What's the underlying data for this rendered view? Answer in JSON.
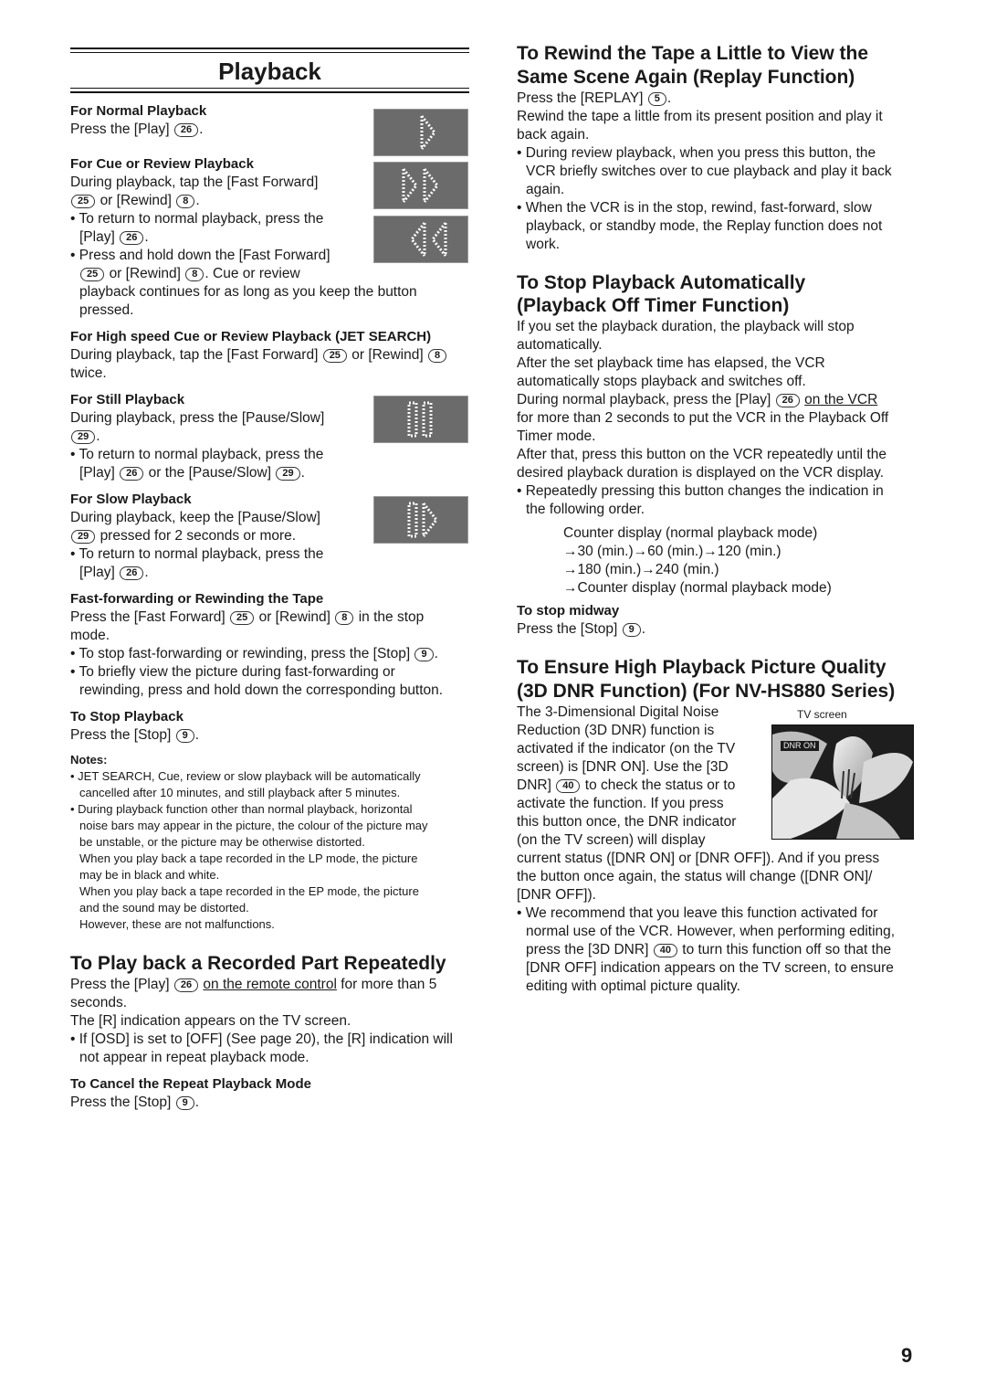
{
  "page_title": "Playback",
  "page_number": "9",
  "left": {
    "normal": {
      "heading": "For Normal Playback",
      "line1_pre": "Press the [Play]",
      "line1_key": "26",
      "line1_post": "."
    },
    "cue": {
      "heading": "For Cue or Review Playback",
      "l1": "During playback, tap the [Fast Forward]",
      "l2_key1": "25",
      "l2_mid": "or [Rewind]",
      "l2_key2": "8",
      "l2_post": ".",
      "b1_l1": "• To return to normal playback, press the",
      "b1_l2_pre": "[Play]",
      "b1_l2_key": "26",
      "b1_l2_post": ".",
      "b2_l1": "• Press and hold down the [Fast Forward]",
      "b2_l2_key1": "25",
      "b2_l2_mid": "or [Rewind]",
      "b2_l2_key2": "8",
      "b2_l2_post": ". Cue or review",
      "b2_l3": "playback continues for as long as you keep the button",
      "b2_l4": "pressed."
    },
    "jet": {
      "heading": "For High speed Cue or Review Playback (JET SEARCH)",
      "l1_pre": "During playback, tap the [Fast Forward]",
      "l1_key1": "25",
      "l1_mid": "or [Rewind]",
      "l1_key2": "8",
      "l2": "twice."
    },
    "still": {
      "heading": "For Still Playback",
      "l1": "During playback, press the [Pause/Slow]",
      "l2_key": "29",
      "l2_post": ".",
      "b1_l1": "• To return to normal playback, press the",
      "b1_l2_pre": "[Play]",
      "b1_l2_key1": "26",
      "b1_l2_mid": "or the [Pause/Slow]",
      "b1_l2_key2": "29",
      "b1_l2_post": "."
    },
    "slow": {
      "heading": "For Slow Playback",
      "l1": "During playback, keep the [Pause/Slow]",
      "l2_key": "29",
      "l2_post": "pressed for 2 seconds or more.",
      "b1_l1": "• To return to normal playback, press the",
      "b1_l2_pre": "[Play]",
      "b1_l2_key": "26",
      "b1_l2_post": "."
    },
    "ffrew": {
      "heading": "Fast-forwarding or Rewinding the Tape",
      "l1_pre": "Press the [Fast Forward]",
      "l1_key1": "25",
      "l1_mid": "or [Rewind]",
      "l1_key2": "8",
      "l1_post": "in the stop",
      "l2": "mode.",
      "b1_pre": "• To stop fast-forwarding or rewinding, press the [Stop]",
      "b1_key": "9",
      "b1_post": ".",
      "b2_l1": "• To briefly view the picture during fast-forwarding or",
      "b2_l2": "rewinding, press and hold down the corresponding button."
    },
    "stop": {
      "heading": "To Stop Playback",
      "l1_pre": "Press the [Stop]",
      "l1_key": "9",
      "l1_post": "."
    },
    "notes": {
      "heading": "Notes:",
      "lines": [
        "• JET SEARCH, Cue, review or slow playback will be automatically",
        "cancelled after 10 minutes, and still playback after 5 minutes.",
        "• During playback function other than normal playback, horizontal",
        "noise bars may appear in the picture, the colour of the picture may",
        "be unstable, or the picture may be otherwise distorted.",
        "When you play back a tape recorded in the LP mode, the picture",
        "may be in black and white.",
        "When you play back a tape recorded in the EP mode, the picture",
        "and the sound may be distorted.",
        "However, these are not malfunctions."
      ]
    },
    "repeat": {
      "heading": "To Play back a Recorded Part Repeatedly",
      "l1_pre": "Press the [Play]",
      "l1_key": "26",
      "l1_link": "on the remote control",
      "l1_post": "for more than 5",
      "l2": "seconds.",
      "l3": "The [R] indication appears on the TV screen.",
      "b1_l1": "• If [OSD] is set to [OFF] (See page 20), the [R] indication will",
      "b1_l2": "not appear in repeat playback mode.",
      "cancel_heading": "To Cancel the Repeat Playback Mode",
      "cancel_pre": "Press the [Stop]",
      "cancel_key": "9",
      "cancel_post": "."
    }
  },
  "right": {
    "replay": {
      "heading_l1": "To Rewind the Tape a Little to View the",
      "heading_l2": "Same Scene Again (Replay Function)",
      "l1_pre": "Press the [REPLAY]",
      "l1_key": "5",
      "l1_post": ".",
      "l2": "Rewind the tape a little from its present position and play it",
      "l3": "back again.",
      "b1_l1": "• During review playback, when you press this button, the",
      "b1_l2": "VCR briefly switches over to cue playback and play it back",
      "b1_l3": "again.",
      "b2_l1": "• When the VCR is in the stop, rewind, fast-forward, slow",
      "b2_l2": "playback, or standby mode, the Replay function does not",
      "b2_l3": "work."
    },
    "offtimer": {
      "heading_l1": "To Stop Playback Automatically",
      "heading_l2": "(Playback Off Timer Function)",
      "l1": "If you set the playback duration, the playback will stop",
      "l2": "automatically.",
      "l3": "After the set playback time has elapsed, the VCR",
      "l4": "automatically stops playback and switches off.",
      "l5_pre": "During normal playback, press the [Play]",
      "l5_key": "26",
      "l5_link": "on the VCR",
      "l6": "for more than 2 seconds to put the VCR in the Playback Off",
      "l7": "Timer mode.",
      "l8": "After that, press this button on the VCR repeatedly until the",
      "l9": "desired playback duration is displayed on the VCR display.",
      "b1_l1": "• Repeatedly pressing this button changes the indication in",
      "b1_l2": "the following order.",
      "seq": [
        "Counter display (normal playback mode)",
        "→30 (min.)→60 (min.)→120 (min.)",
        "→180 (min.)→240 (min.)",
        "→Counter display (normal playback mode)"
      ],
      "midway_heading": "To stop midway",
      "midway_pre": "Press the [Stop]",
      "midway_key": "9",
      "midway_post": "."
    },
    "dnr": {
      "heading_l1": "To Ensure High Playback Picture Quality",
      "heading_l2": "(3D DNR Function) (For NV-HS880 Series)",
      "tv_caption": "TV screen",
      "tv_osd": "DNR ON",
      "w1": "The 3-Dimensional Digital Noise",
      "w2": "Reduction (3D DNR) function is",
      "w3": "activated if the indicator (on the TV",
      "w4": "screen) is [DNR ON]. Use the [3D",
      "w5_pre": "DNR]",
      "w5_key": "40",
      "w5_post": "to check the status or to",
      "w6": "activate the function. If you press",
      "w7": "this button once, the DNR indicator",
      "w8": "(on the TV screen) will display",
      "l9": "current status ([DNR ON] or [DNR OFF]). And if you press",
      "l10": "the button once again, the status will change ([DNR ON]/",
      "l11": "[DNR OFF]).",
      "b1_l1": "• We recommend that you leave this function activated for",
      "b1_l2": "normal use of the VCR. However, when performing editing,",
      "b1_l3_pre": "press the [3D DNR]",
      "b1_l3_key": "40",
      "b1_l3_post": "to turn this function off so that the",
      "b1_l4": "[DNR OFF] indication appears on the TV screen, to ensure",
      "b1_l5": "editing with optimal picture quality."
    }
  }
}
